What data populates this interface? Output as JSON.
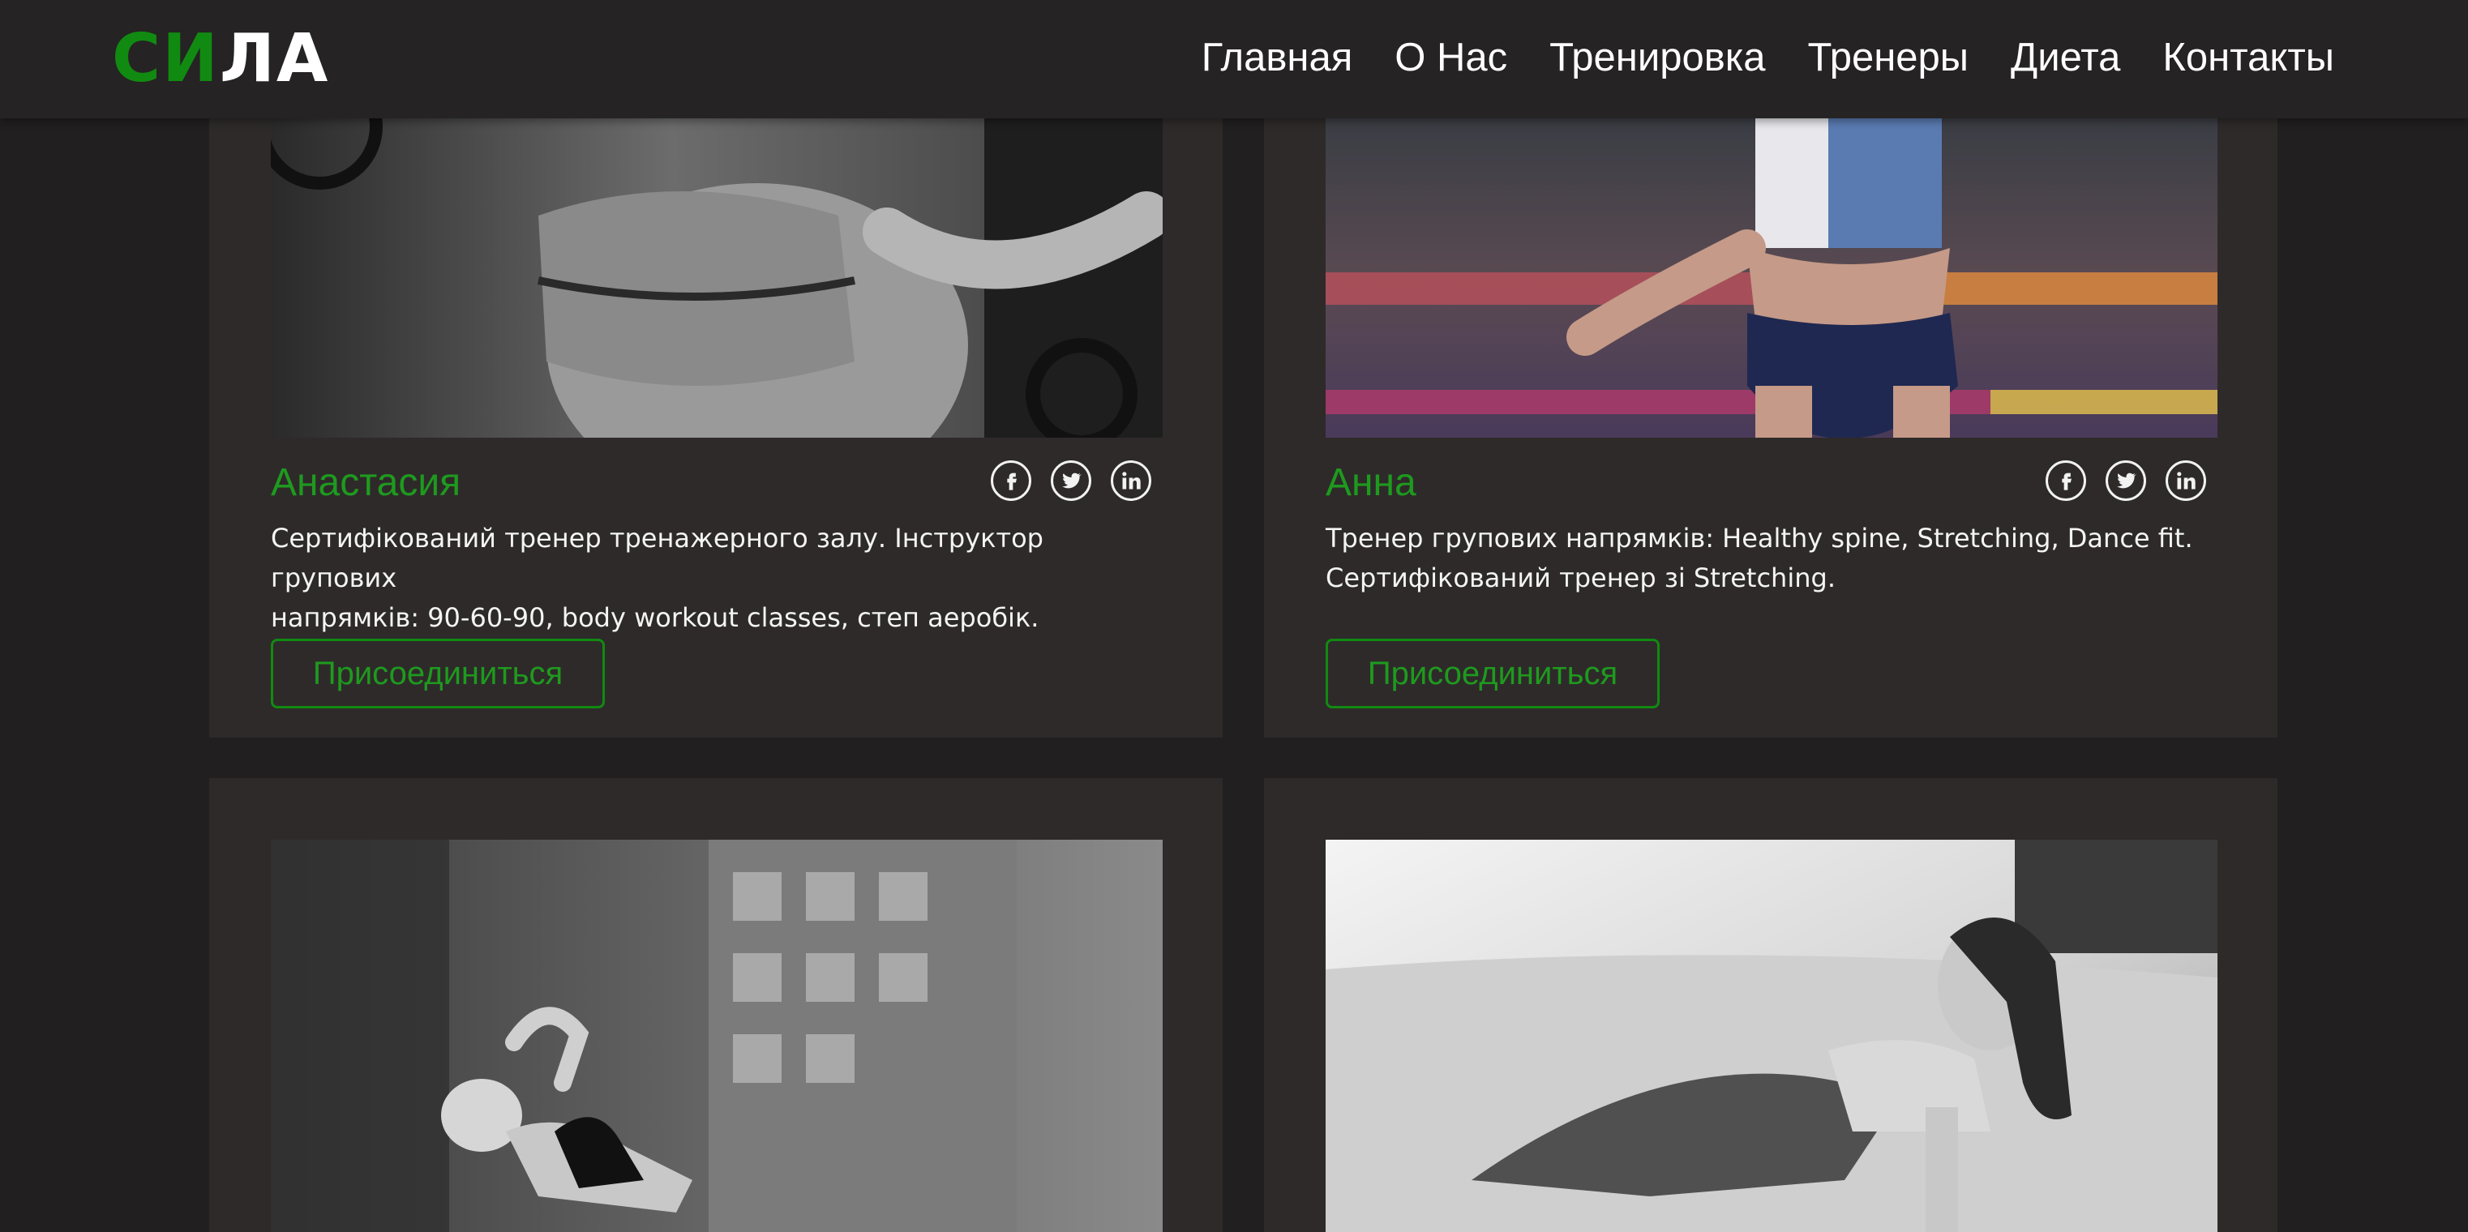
{
  "header": {
    "logo_green": "СИ",
    "logo_white": "ЛА",
    "nav": [
      "Главная",
      "О Нас",
      "Тренировка",
      "Тренеры",
      "Диета",
      "Контакты"
    ]
  },
  "trainers": [
    {
      "name": "Анастасия",
      "desc_line1": "Сертифікований тренер тренажерного залу. Інструктор групових",
      "desc_line2": "напрямків: 90-60-90, body workout classes, степ аеробік.",
      "button": "Присоединиться"
    },
    {
      "name": "Анна",
      "desc_line1": "Тренер групових напрямків: Healthy spine, Stretching, Dance fit.",
      "desc_line2": "Сертифікований тренер зі Stretching.",
      "button": "Присоединиться"
    }
  ],
  "icons": [
    "facebook-icon",
    "twitter-icon",
    "linkedin-icon"
  ],
  "colors": {
    "accent": "#118a11",
    "background": "#211f1f",
    "card": "#2e2a2a",
    "header": "#252323"
  }
}
